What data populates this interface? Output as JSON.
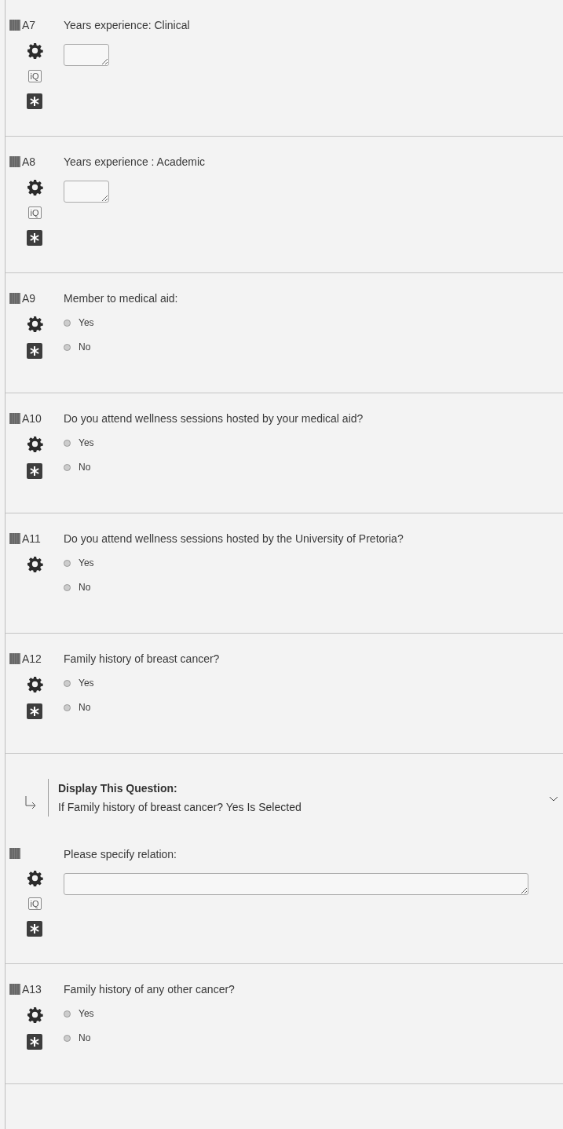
{
  "questions": [
    {
      "kind": "short_text",
      "label": "A7",
      "text": "Years experience: Clinical",
      "iq": "iQ",
      "required": true
    },
    {
      "kind": "short_text",
      "label": "A8",
      "text": "Years experience : Academic",
      "iq": "iQ",
      "required": true
    },
    {
      "kind": "multiple_choice",
      "label": "A9",
      "text": "Member to medical aid:",
      "choices": [
        {
          "text": "Yes",
          "selected": false
        },
        {
          "text": "No",
          "selected": false
        }
      ],
      "required": true
    },
    {
      "kind": "multiple_choice",
      "label": "A10",
      "text": "Do you attend wellness sessions hosted by your medical aid?",
      "choices": [
        {
          "text": "Yes",
          "selected": false
        },
        {
          "text": "No",
          "selected": false
        }
      ],
      "required": true
    },
    {
      "kind": "multiple_choice",
      "label": "A11",
      "text": "Do you attend wellness sessions hosted by the University of Pretoria?",
      "choices": [
        {
          "text": "Yes",
          "selected": false
        },
        {
          "text": "No",
          "selected": false
        }
      ],
      "required": false
    },
    {
      "kind": "multiple_choice",
      "label": "A12",
      "text": "Family history of breast cancer?",
      "choices": [
        {
          "text": "Yes",
          "selected": false
        },
        {
          "text": "No",
          "selected": false
        }
      ],
      "required": true
    },
    {
      "kind": "wide_text",
      "display_logic": {
        "heading": "Display This Question:",
        "condition": "If Family history of breast cancer? Yes Is Selected"
      },
      "text": "Please specify relation:",
      "iq": "iQ",
      "required": true
    },
    {
      "kind": "multiple_choice",
      "label": "A13",
      "text": "Family history of any other cancer?",
      "choices": [
        {
          "text": "Yes",
          "selected": false
        },
        {
          "text": "No",
          "selected": false
        }
      ],
      "required": true
    }
  ]
}
